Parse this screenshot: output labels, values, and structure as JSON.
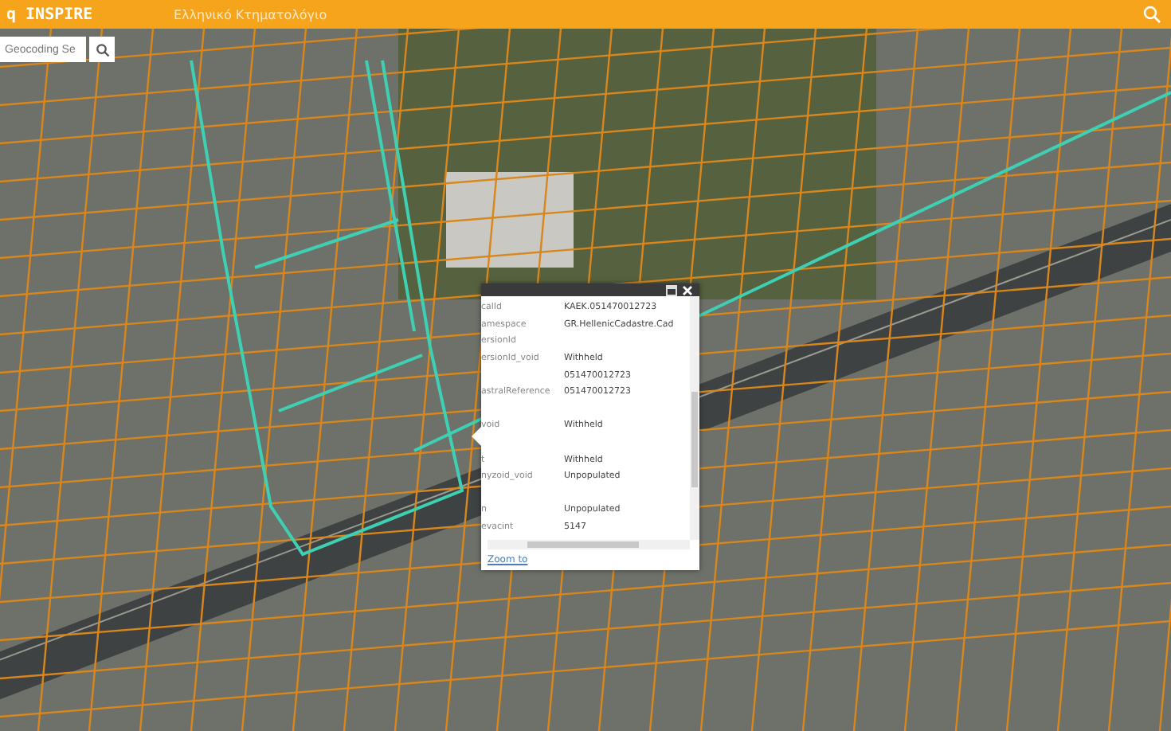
{
  "header": {
    "title": "q INSPIRE",
    "subtitle": "Ελληνικό Κτηματολόγιο"
  },
  "search": {
    "placeholder": "Geocoding Se"
  },
  "popup": {
    "rows": [
      {
        "label": "calId",
        "value": "KAEK.051470012723"
      },
      {
        "label": "amespace",
        "value": "GR.HellenicCadastre.Cad"
      },
      {
        "label": "ersionId",
        "value": ""
      },
      {
        "label": "ersionId_void",
        "value": "Withheld"
      },
      {
        "label": "",
        "value": "051470012723"
      },
      {
        "label": "astralReference",
        "value": "051470012723"
      },
      {
        "label": "",
        "value": ""
      },
      {
        "label": "void",
        "value": "Withheld"
      },
      {
        "label": "",
        "value": ""
      },
      {
        "label": "t",
        "value": "Withheld"
      },
      {
        "label": "nyzoid_void",
        "value": "Unpopulated"
      },
      {
        "label": "",
        "value": ""
      },
      {
        "label": "n",
        "value": "Unpopulated"
      },
      {
        "label": "evacint",
        "value": "5147"
      }
    ],
    "link": "Zoom to"
  }
}
